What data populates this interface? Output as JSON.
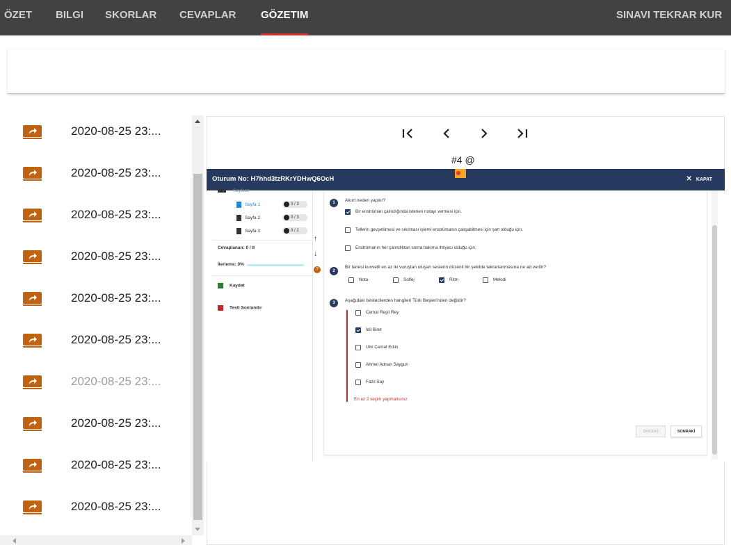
{
  "nav": {
    "tabs": [
      {
        "label": "ÖZET"
      },
      {
        "label": "BILGI"
      },
      {
        "label": "SKORLAR"
      },
      {
        "label": "CEVAPLAR"
      },
      {
        "label": "GÖZETIM"
      }
    ],
    "active_tab": "GÖZETIM",
    "retake_label": "SINAVI TEKRAR KUR"
  },
  "snapshots": {
    "items": [
      {
        "time": "2020-08-25 23:..."
      },
      {
        "time": "2020-08-25 23:..."
      },
      {
        "time": "2020-08-25 23:..."
      },
      {
        "time": "2020-08-25 23:..."
      },
      {
        "time": "2020-08-25 23:..."
      },
      {
        "time": "2020-08-25 23:..."
      },
      {
        "time": "2020-08-25 23:..."
      },
      {
        "time": "2020-08-25 23:..."
      },
      {
        "time": "2020-08-25 23:..."
      },
      {
        "time": "2020-08-25 23:..."
      }
    ],
    "selected_index": 6,
    "icon": "share-arrow-icon"
  },
  "viewer": {
    "caption": "#4 @",
    "controls": [
      "first-page-icon",
      "prev-icon",
      "next-icon",
      "last-page-icon"
    ]
  },
  "screenshot": {
    "session_title": "Oturum No: H7hhd3tzRKrYDHwQ6OcH",
    "close_label": "KAPAT",
    "sidebar": {
      "heading": "Sayfalar",
      "pages": [
        {
          "label": "Sayfa 1",
          "progress": "0 / 3"
        },
        {
          "label": "Sayfa 2",
          "progress": "0 / 3"
        },
        {
          "label": "Sayfa 3",
          "progress": "0 / 2"
        }
      ],
      "answered": "Cevaplanan: 0 / 8",
      "progress_label": "İlerleme: 0%",
      "save_label": "Kaydet",
      "finish_label": "Testi Sonlandır"
    },
    "questions": [
      {
        "number": "1",
        "text": "Akort neden yapılır?",
        "options": [
          {
            "label": "Bir enstrüman çalındığında istenen notayı vermesi için.",
            "checked": true
          },
          {
            "label": "Tellerin gevşetilmesi ve sıkılması işlemi enstrümanın çalışabilmesi için şart olduğu için.",
            "checked": false
          },
          {
            "label": "Enstrümanın her çalındıktan sonra bakıma ihtiyacı olduğu için.",
            "checked": false
          }
        ]
      },
      {
        "number": "2",
        "text": "Bir tanesi kuvvetli en az iki vuruştan oluşan seslerin düzenli bir şekilde tekrarlanmasına ne ad verilir?",
        "options": [
          {
            "label": "Nota",
            "checked": false
          },
          {
            "label": "Solfej",
            "checked": false
          },
          {
            "label": "Ritm",
            "checked": true
          },
          {
            "label": "Melodi",
            "checked": false
          }
        ]
      },
      {
        "number": "3",
        "text": "Aşağıdaki bestecilerden hangileri Türk  Beşleri'nden değildir?",
        "options": [
          {
            "label": "Cemal Reşit Rey",
            "checked": false
          },
          {
            "label": "İdil Biret",
            "checked": true
          },
          {
            "label": "Ulvi Cemal Erkin",
            "checked": false
          },
          {
            "label": "Ahmet Adnan Saygun",
            "checked": false
          },
          {
            "label": "Fazıl Say",
            "checked": false
          }
        ],
        "error": "En az 2 seçim yapmalısınız"
      }
    ],
    "prev_label": "ÖNCEKİ",
    "next_label": "SONRAKİ"
  },
  "colors": {
    "nav_bg": "#424242",
    "active_underline": "#d32f2f",
    "share_icon": "#c0620f",
    "session_header": "#253a5e",
    "error": "#c62828"
  }
}
